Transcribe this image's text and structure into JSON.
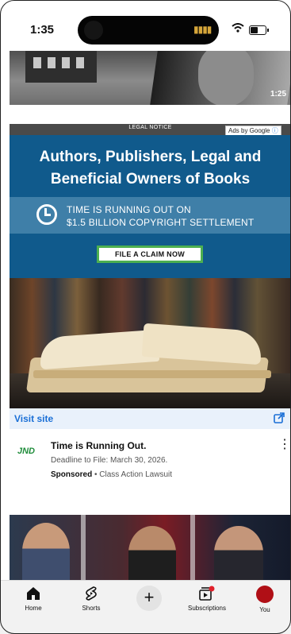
{
  "status_bar": {
    "time": "1:35"
  },
  "top_video": {
    "duration": "1:25"
  },
  "ad": {
    "legal_notice": "LEGAL NOTICE",
    "ads_by": "Ads by Google",
    "headline_line1": "Authors, Publishers, Legal and",
    "headline_line2": "Beneficial Owners of Books",
    "band_line1": "TIME IS RUNNING OUT ON",
    "band_line2": "$1.5 BILLION COPYRIGHT SETTLEMENT",
    "cta": "FILE A CLAIM NOW",
    "visit_site": "Visit site",
    "advertiser_logo": "JND",
    "title": "Time is Running Out.",
    "subtitle": "Deadline to File: March 30, 2026.",
    "sponsored": "Sponsored",
    "advertiser": "• Class Action Lawsuit"
  },
  "nav": {
    "items": [
      {
        "label": "Home",
        "icon": "home-icon"
      },
      {
        "label": "Shorts",
        "icon": "shorts-icon"
      },
      {
        "label": "",
        "icon": "create-plus-icon"
      },
      {
        "label": "Subscriptions",
        "icon": "subscriptions-icon"
      },
      {
        "label": "You",
        "icon": "avatar"
      }
    ]
  },
  "colors": {
    "ad_blue": "#105a8c",
    "cta_border": "#4caf50",
    "link_blue": "#1a6fd6",
    "avatar": "#b00f16"
  }
}
